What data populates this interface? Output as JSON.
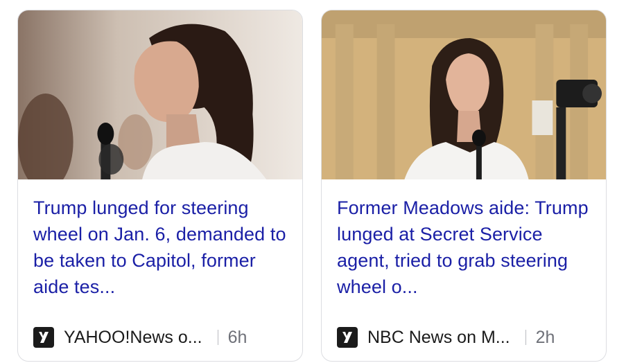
{
  "cards": [
    {
      "headline": "Trump lunged for steering wheel on Jan. 6, demanded to be taken to Capitol, former aide tes...",
      "source": "YAHOO!News o...",
      "age": "6h",
      "thumbnail_icon": "testimony-photo"
    },
    {
      "headline": "Former Meadows aide: Trump lunged at Secret Service agent, tried to grab steering wheel o...",
      "source": "NBC News on M...",
      "age": "2h",
      "thumbnail_icon": "testimony-photo"
    }
  ],
  "colors": {
    "headline": "#1a1fa6",
    "source": "#1b1b1b",
    "age": "#6e7078",
    "card_border": "#dcdde1"
  }
}
